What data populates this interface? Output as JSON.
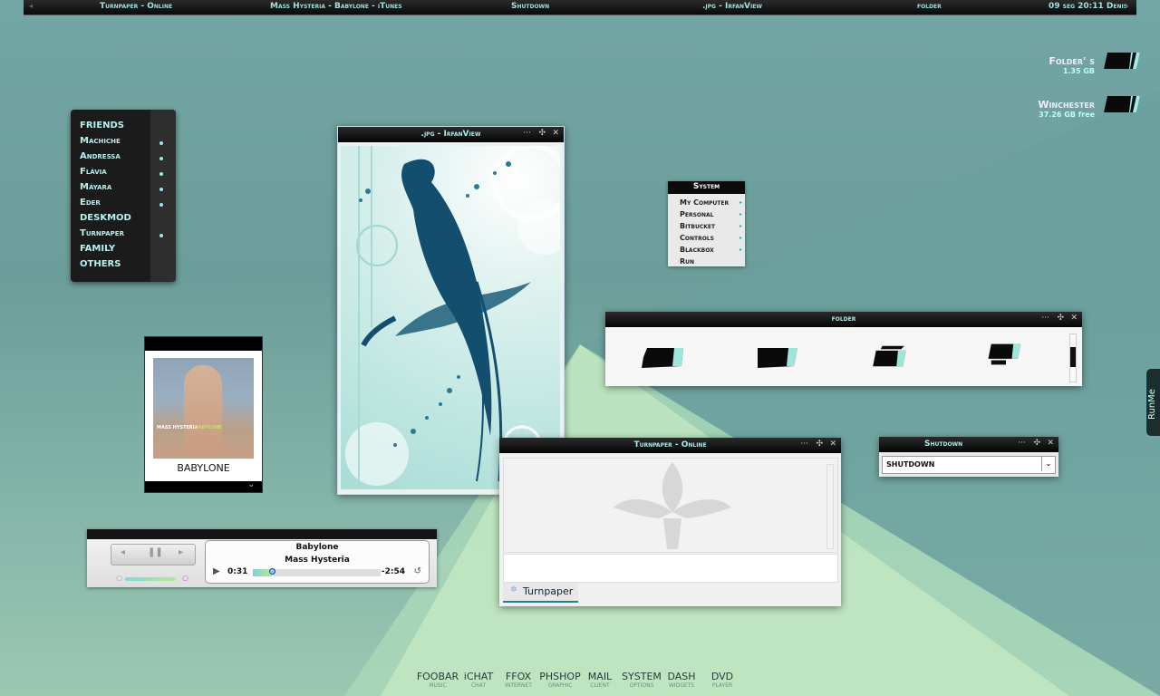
{
  "topbar": {
    "items": [
      "Turnpaper - Online",
      "Mass Hysteria - Babylone - iTunes",
      "Shutdown",
      ".jpg - IrfanView",
      "folder",
      "09 seg 20:11 Denis"
    ]
  },
  "drives": [
    {
      "name": "Folder' s",
      "sub": "1.35 GB"
    },
    {
      "name": "Winchester",
      "sub": "37.26 GB free"
    }
  ],
  "friends": {
    "items": [
      {
        "label": "FRIENDS",
        "bullet": false
      },
      {
        "label": "Machiche",
        "bullet": true
      },
      {
        "label": "Andressa",
        "bullet": true
      },
      {
        "label": "Flávia",
        "bullet": true
      },
      {
        "label": "Máyara",
        "bullet": true
      },
      {
        "label": "Eder",
        "bullet": true
      },
      {
        "label": "DESKMOD",
        "bullet": false
      },
      {
        "label": "Turnpaper",
        "bullet": true
      },
      {
        "label": "FAMILY",
        "bullet": false
      },
      {
        "label": "OTHERS",
        "bullet": false
      }
    ]
  },
  "album": {
    "title": "BABYLONE",
    "art_text_left": "MASS HYSTERIA",
    "art_text_right": "BABYLONE"
  },
  "irfan": {
    "title": ".jpg - IrfanView"
  },
  "sysmenu": {
    "title": "System",
    "items": [
      {
        "label": "My Computer",
        "submenu": true
      },
      {
        "label": "Personal",
        "submenu": true
      },
      {
        "label": "Bitbucket",
        "submenu": true
      },
      {
        "label": "Controls",
        "submenu": true
      },
      {
        "label": "Blackbox",
        "submenu": true
      },
      {
        "label": "Run",
        "submenu": false
      }
    ]
  },
  "folder": {
    "title": "folder"
  },
  "turnpaper": {
    "title": "Turnpaper - Online",
    "tab_label": "Turnpaper"
  },
  "shutdown": {
    "title": "Shutdown",
    "selected": "SHUTDOWN"
  },
  "player": {
    "song": "Babylone",
    "artist": "Mass Hysteria",
    "elapsed": "0:31",
    "remaining": "-2:54",
    "progress": 0.15
  },
  "dock": [
    {
      "label": "FOOBAR",
      "sub": "MUSIC"
    },
    {
      "label": "iCHAT",
      "sub": "CHAT"
    },
    {
      "label": "FFOX",
      "sub": "INTERNET"
    },
    {
      "label": "PHSHOP",
      "sub": "GRAPHIC"
    },
    {
      "label": "MAIL",
      "sub": "CLIENT"
    },
    {
      "label": "SYSTEM",
      "sub": "OPTIONS"
    },
    {
      "label": "DASH",
      "sub": "WIDGETS"
    },
    {
      "label": "DVD",
      "sub": "PLAYER"
    }
  ],
  "runme": {
    "label": "RunMe"
  },
  "window_controls": {
    "minimize": "···",
    "move": "✣",
    "close": "✕"
  },
  "colors": {
    "accent": "#a9ecec",
    "bg": "#6e9e9b"
  }
}
